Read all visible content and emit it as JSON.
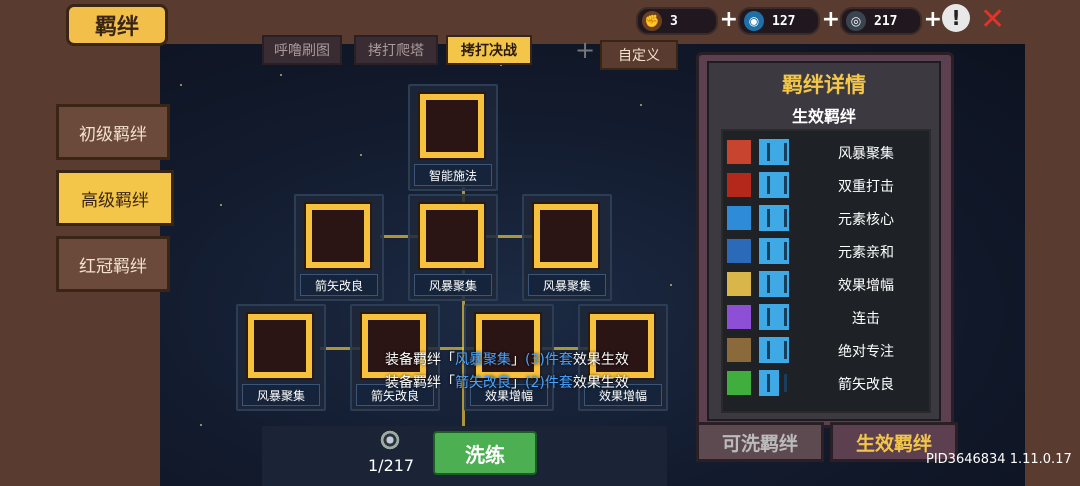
{
  "header": {
    "title": "羁绊",
    "currencies": [
      {
        "icon": "fist-icon",
        "value": "3",
        "color": "#e0a040"
      },
      {
        "icon": "gem-icon",
        "value": "127",
        "color": "#3fb0e8"
      },
      {
        "icon": "ring-icon",
        "value": "217",
        "color": "#9ab"
      }
    ],
    "plus": "+",
    "alert": "!",
    "close": "✕"
  },
  "sidebar": {
    "items": [
      {
        "label": "初级羁绊",
        "active": false
      },
      {
        "label": "高级羁绊",
        "active": true
      },
      {
        "label": "红冠羁绊",
        "active": false
      }
    ]
  },
  "tabs": {
    "items": [
      {
        "label": "呼噜刷图",
        "active": false
      },
      {
        "label": "拷打爬塔",
        "active": false
      },
      {
        "label": "拷打决战",
        "active": true
      }
    ],
    "add": "+",
    "custom": "自定义"
  },
  "tree": {
    "nodes": [
      {
        "label": "智能施法",
        "art": "smart"
      },
      {
        "label": "箭矢改良",
        "art": "arrow"
      },
      {
        "label": "风暴聚集",
        "art": "storm"
      },
      {
        "label": "风暴聚集",
        "art": "storm"
      },
      {
        "label": "风暴聚集",
        "art": "storm"
      },
      {
        "label": "箭矢改良",
        "art": "arrow"
      },
      {
        "label": "效果增幅",
        "art": "effect"
      },
      {
        "label": "效果增幅",
        "art": "effect"
      }
    ]
  },
  "tooltip": {
    "line1": {
      "prefix": "装备羁绊「",
      "name": "风暴聚集",
      "mid": "」",
      "count": "(3)件套",
      "suffix": "效果生效"
    },
    "line2": {
      "prefix": "装备羁绊「",
      "name": "箭矢改良",
      "mid": "」",
      "count": "(2)件套",
      "suffix": "效果生效"
    }
  },
  "bottom": {
    "count": "1/217",
    "wash_button": "洗练"
  },
  "panel": {
    "title": "羁绊详情",
    "subtitle": "生效羁绊",
    "rows": [
      {
        "name": "风暴聚集",
        "icon": "storm-icon",
        "color": "#c8442e"
      },
      {
        "name": "双重打击",
        "icon": "double-strike-icon",
        "color": "#b4281c"
      },
      {
        "name": "元素核心",
        "icon": "element-core-icon",
        "color": "#2d8bd8"
      },
      {
        "name": "元素亲和",
        "icon": "element-affinity-icon",
        "color": "#2a6ab8"
      },
      {
        "name": "效果增幅",
        "icon": "effect-amp-icon",
        "color": "#d9b64a"
      },
      {
        "name": "连击",
        "icon": "combo-icon",
        "color": "#8d4fd6"
      },
      {
        "name": "绝对专注",
        "icon": "hourglass-icon",
        "color": "#8a6a3a"
      },
      {
        "name": "箭矢改良",
        "icon": "arrow-icon",
        "color": "#3fae3f"
      }
    ],
    "tab_left": "可洗羁绊",
    "tab_right": "生效羁绊"
  },
  "footer": {
    "pid": "PID3646834 1.11.0.17"
  }
}
